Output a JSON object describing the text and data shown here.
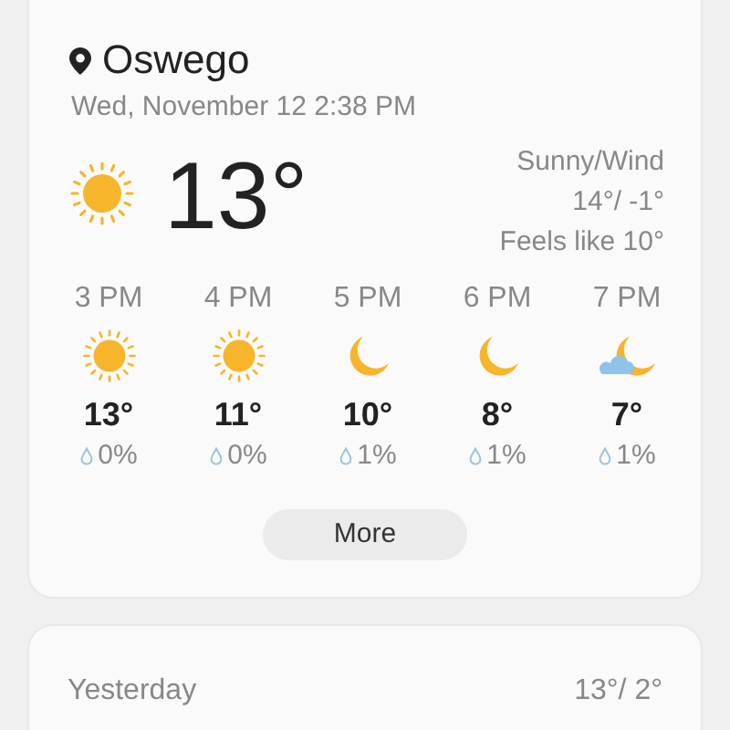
{
  "location": {
    "name": "Oswego",
    "datetime": "Wed, November 12 2:38 PM"
  },
  "current": {
    "kind": "sun",
    "temperature": "13°",
    "condition": "Sunny/Wind",
    "high_low": "14°/ -1°",
    "feels_like": "Feels like 10°"
  },
  "hourly": [
    {
      "time": "3 PM",
      "kind": "sun",
      "temperature": "13°",
      "precipitation": "0%"
    },
    {
      "time": "4 PM",
      "kind": "sun",
      "temperature": "11°",
      "precipitation": "0%"
    },
    {
      "time": "5 PM",
      "kind": "moon",
      "temperature": "10°",
      "precipitation": "1%"
    },
    {
      "time": "6 PM",
      "kind": "moon",
      "temperature": "8°",
      "precipitation": "1%"
    },
    {
      "time": "7 PM",
      "kind": "moon-cloud",
      "temperature": "7°",
      "precipitation": "1%"
    }
  ],
  "more_button": "More",
  "yesterday": {
    "label": "Yesterday",
    "high_low": "13°/ 2°"
  }
}
